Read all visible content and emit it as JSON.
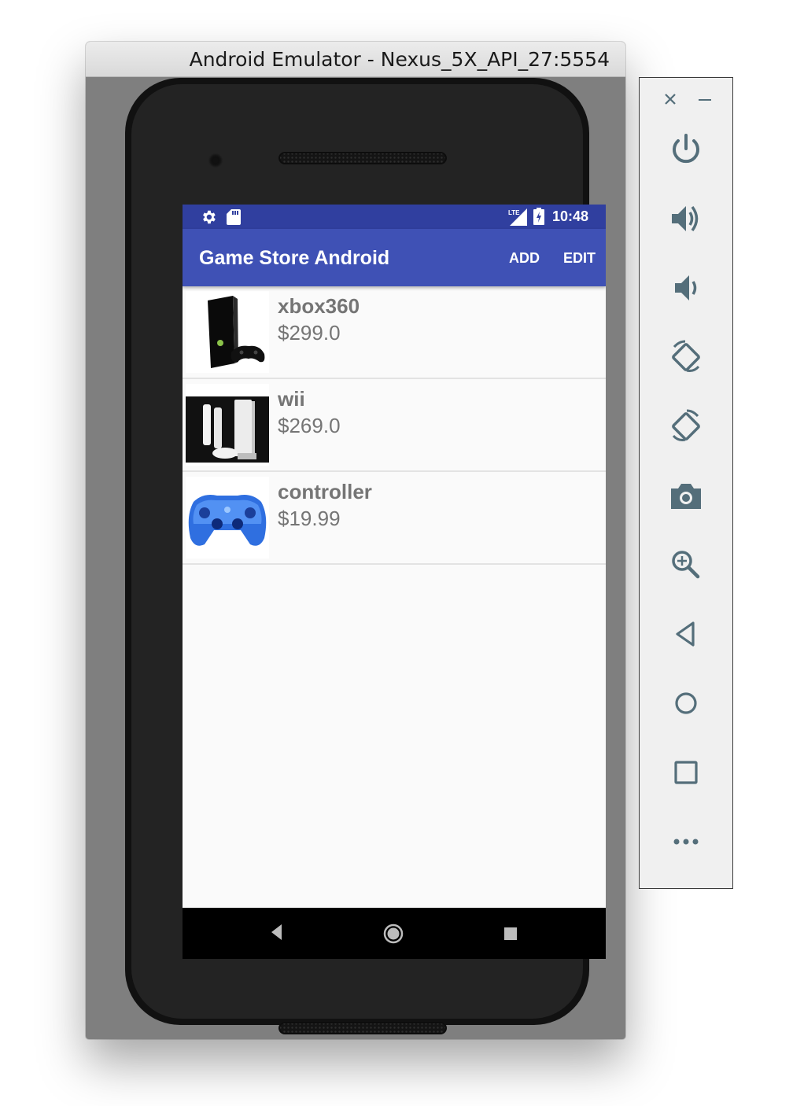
{
  "window": {
    "title": "Android Emulator - Nexus_5X_API_27:5554"
  },
  "statusbar": {
    "time": "10:48",
    "icons": [
      "settings-icon",
      "sd-card-icon",
      "lte-signal-icon",
      "battery-charging-icon"
    ]
  },
  "appbar": {
    "title": "Game Store Android",
    "add_label": "ADD",
    "edit_label": "EDIT"
  },
  "products": [
    {
      "name": "xbox360",
      "price": "$299.0",
      "image": "xbox360-console-image"
    },
    {
      "name": "wii",
      "price": "$269.0",
      "image": "wii-console-image"
    },
    {
      "name": "controller",
      "price": "$19.99",
      "image": "blue-controller-image"
    }
  ],
  "navbar": {
    "icons": [
      "back-icon",
      "home-icon",
      "recents-icon"
    ]
  },
  "toolbar": {
    "icons": [
      "close-icon",
      "minimize-icon",
      "power-icon",
      "volume-up-icon",
      "volume-down-icon",
      "rotate-left-icon",
      "rotate-right-icon",
      "camera-icon",
      "zoom-icon",
      "back-icon",
      "home-icon",
      "overview-icon",
      "more-icon"
    ]
  },
  "colors": {
    "primary": "#3f51b5",
    "primary_dark": "#303f9f",
    "toolbar_icon": "#546e7a"
  }
}
